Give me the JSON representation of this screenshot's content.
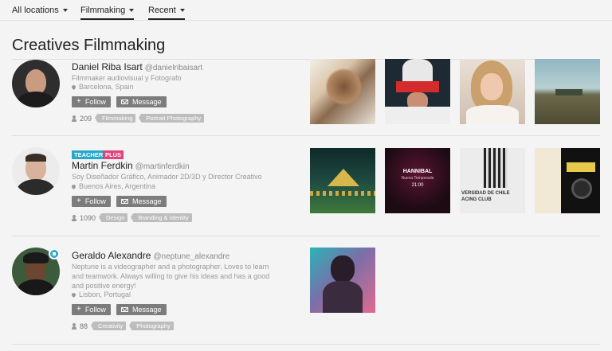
{
  "filters": [
    {
      "label": "All locations",
      "active": false
    },
    {
      "label": "Filmmaking",
      "active": true
    },
    {
      "label": "Recent",
      "active": true
    }
  ],
  "page_title": "Creatives Filmmaking",
  "creatives": [
    {
      "name": "Daniel Riba Isart",
      "handle": "@danielribaisart",
      "description": "Filmmaker audiovisual y Fotografo",
      "location": "Barcelona, Spain",
      "follow_label": "Follow",
      "message_label": "Message",
      "followers": "209",
      "tags": [
        "Filmmaking",
        "Portrait Photography"
      ],
      "labels": [],
      "has_pro_badge": false
    },
    {
      "name": "Martin Ferdkin",
      "handle": "@martinferdkin",
      "description": "Soy Diseñador Gráfico, Animador 2D/3D y Director Creativo",
      "location": "Buenos Aires, Argentina",
      "follow_label": "Follow",
      "message_label": "Message",
      "followers": "1090",
      "tags": [
        "Design",
        "Branding & Identity"
      ],
      "labels": [
        "TEACHER",
        "PLUS"
      ],
      "has_pro_badge": false
    },
    {
      "name": "Geraldo Alexandre",
      "handle": "@neptune_alexandre",
      "description": "Neptune is a videographer and a photographer. Loves to learn and teamwork. Always willing to give his ideas and has a good and positive energy!",
      "location": "Lisbon, Portugal",
      "follow_label": "Follow",
      "message_label": "Message",
      "followers": "88",
      "tags": [
        "Creativity",
        "Photography"
      ],
      "labels": [],
      "has_pro_badge": true
    }
  ],
  "thumbnail_text": {
    "hannibal_title": "HANNIBAL",
    "hannibal_sub": "Nueva Temporada",
    "hannibal_time": "21:00",
    "chile": "VERSIDAD DE CHILE",
    "chile_sub": "ACING CLUB"
  },
  "colors": {
    "teacher": "#28a7c9",
    "plus": "#e0437a",
    "button": "#7c7c7c",
    "tag": "#bdbdbd"
  }
}
